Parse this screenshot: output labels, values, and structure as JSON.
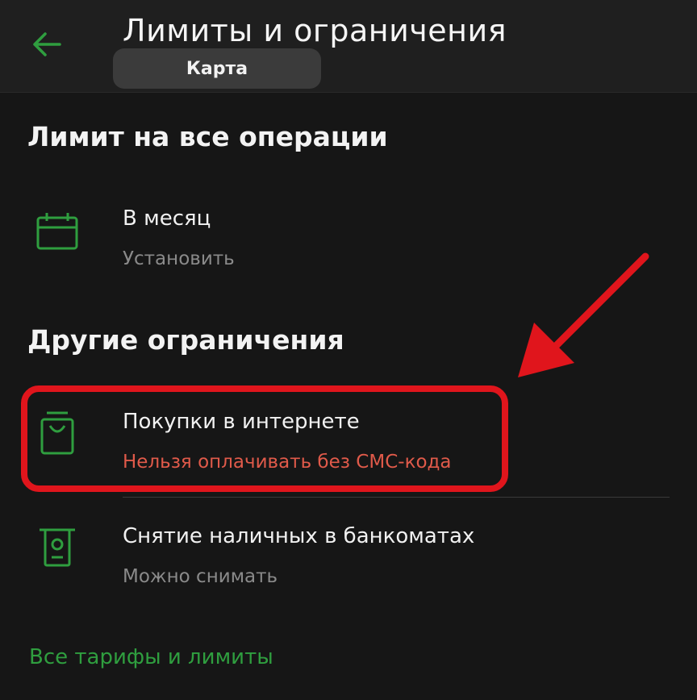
{
  "header": {
    "title": "Лимиты и ограничения",
    "subtitle": "Карта"
  },
  "sections": {
    "all_operations": {
      "title": "Лимит на все операции",
      "items": [
        {
          "title": "В месяц",
          "subtitle": "Установить",
          "icon": "calendar-icon"
        }
      ]
    },
    "other": {
      "title": "Другие ограничения",
      "items": [
        {
          "title": "Покупки в интернете",
          "subtitle": "Нельзя оплачивать без СМС-кода",
          "icon": "shopping-bag-icon"
        },
        {
          "title": "Снятие наличных в банкоматах",
          "subtitle": "Можно снимать",
          "icon": "atm-icon"
        }
      ]
    }
  },
  "footer": {
    "link": "Все тарифы и лимиты"
  },
  "colors": {
    "accent": "#2f9e3f",
    "warning_text": "#e05a4a",
    "highlight": "#e0151c"
  }
}
